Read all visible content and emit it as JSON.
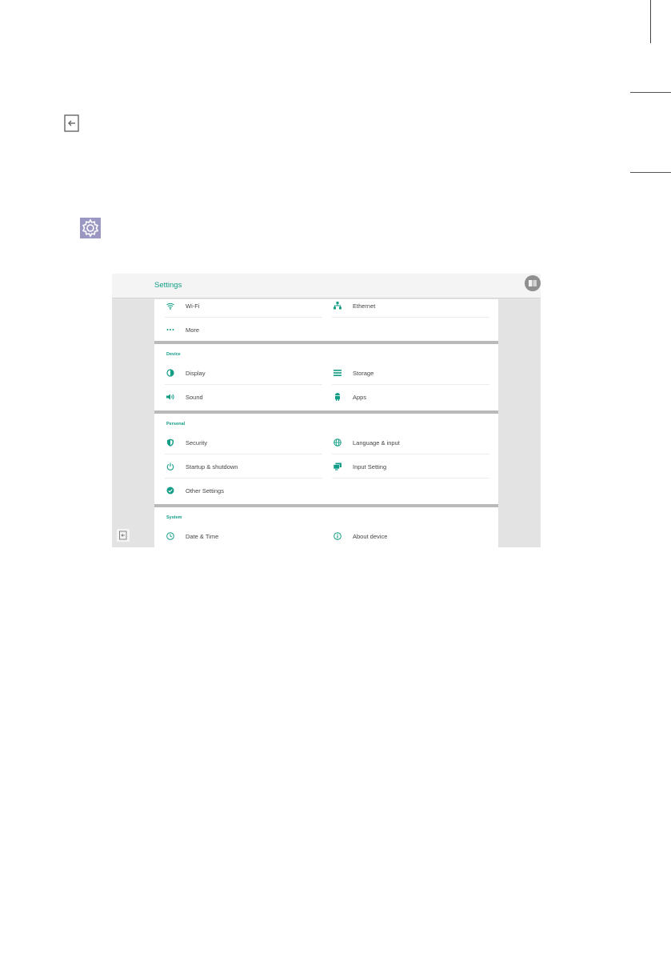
{
  "colors": {
    "accent": "#129d87",
    "panel_divider": "#b9b9b9"
  },
  "document_icons": {
    "exit": "exit-icon",
    "settings": "gear-icon"
  },
  "screen": {
    "title": "Settings",
    "sections": [
      {
        "title": "",
        "items": [
          {
            "label": "Wi-Fi",
            "icon": "wifi-icon"
          },
          {
            "label": "Ethernet",
            "icon": "ethernet-icon"
          },
          {
            "label": "More",
            "icon": "more-icon"
          }
        ]
      },
      {
        "title": "Device",
        "items": [
          {
            "label": "Display",
            "icon": "display-icon"
          },
          {
            "label": "Storage",
            "icon": "storage-icon"
          },
          {
            "label": "Sound",
            "icon": "sound-icon"
          },
          {
            "label": "Apps",
            "icon": "apps-icon"
          }
        ]
      },
      {
        "title": "Personal",
        "items": [
          {
            "label": "Security",
            "icon": "security-icon"
          },
          {
            "label": "Language & input",
            "icon": "globe-icon"
          },
          {
            "label": "Startup & shutdown",
            "icon": "power-icon"
          },
          {
            "label": "Input Setting",
            "icon": "input-icon"
          },
          {
            "label": "Other Settings",
            "icon": "other-settings-icon"
          }
        ]
      },
      {
        "title": "System",
        "items": [
          {
            "label": "Date & Time",
            "icon": "clock-icon"
          },
          {
            "label": "About device",
            "icon": "info-icon"
          }
        ]
      }
    ]
  }
}
